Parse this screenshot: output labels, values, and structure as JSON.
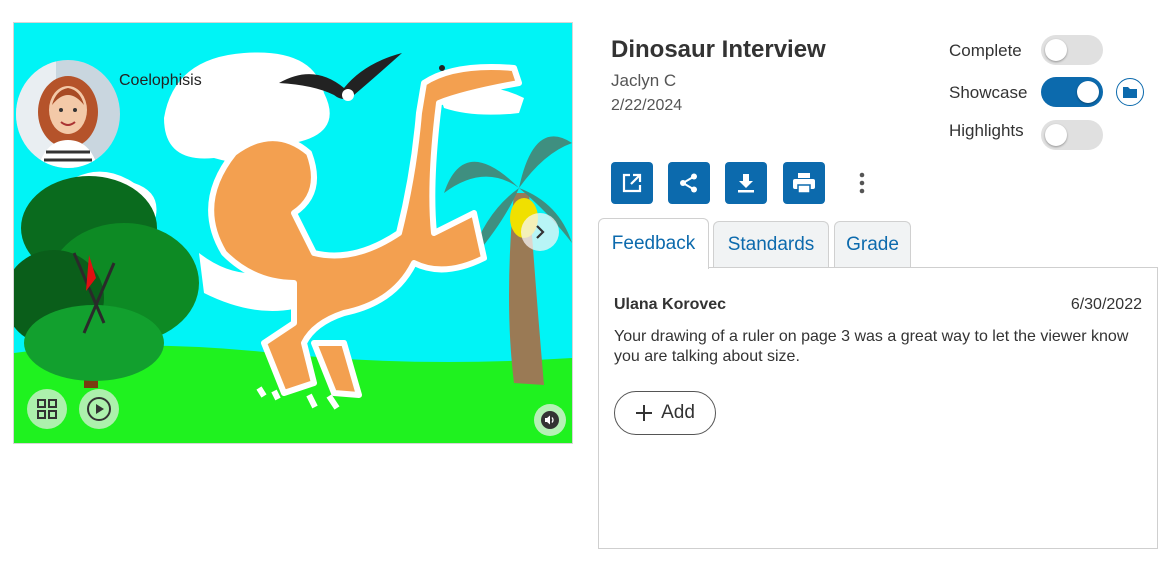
{
  "preview": {
    "caption": "Coelophisis"
  },
  "header": {
    "title": "Dinosaur Interview",
    "author": "Jaclyn C",
    "date": "2/22/2024"
  },
  "toggles": [
    {
      "label": "Complete",
      "on": false
    },
    {
      "label": "Showcase",
      "on": true
    },
    {
      "label": "Highlights",
      "on": false
    }
  ],
  "actions": [
    "open-external-icon",
    "share-icon",
    "download-icon",
    "print-icon",
    "more-vertical-icon"
  ],
  "tabs": [
    {
      "label": "Feedback",
      "active": true
    },
    {
      "label": "Standards",
      "active": false
    },
    {
      "label": "Grade",
      "active": false
    }
  ],
  "feedback": {
    "name": "Ulana Korovec",
    "date": "6/30/2022",
    "text": "Your drawing of a ruler on page 3 was a great way to let the viewer know you are talking about size.",
    "add_label": "Add"
  },
  "colors": {
    "accent": "#0c6aad",
    "sky": "#00f4f6",
    "grass": "#1ff21f"
  }
}
